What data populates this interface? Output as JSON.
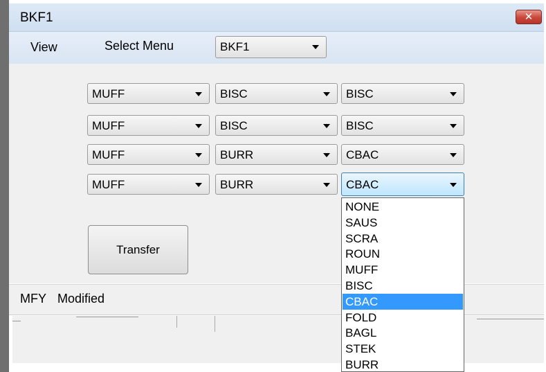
{
  "window": {
    "title": "BKF1",
    "close_label": "✕"
  },
  "menubar": {
    "view_label": "View",
    "select_menu_label": "Select Menu",
    "select_menu_value": "BKF1"
  },
  "grid": {
    "rows": [
      [
        "MUFF",
        "BISC",
        "BISC"
      ],
      [
        "MUFF",
        "BISC",
        "BISC"
      ],
      [
        "MUFF",
        "BURR",
        "CBAC"
      ],
      [
        "MUFF",
        "BURR",
        "CBAC"
      ]
    ]
  },
  "transfer_label": "Transfer",
  "status": {
    "label": "MFY",
    "text": "Modified"
  },
  "dropdown": {
    "options": [
      "NONE",
      "SAUS",
      "SCRA",
      "ROUN",
      "MUFF",
      "BISC",
      "CBAC",
      "FOLD",
      "BAGL",
      "STEK",
      "BURR"
    ],
    "selected": "CBAC"
  },
  "colors": {
    "selection": "#3399ff",
    "close_button": "#c9463a",
    "titlebar": "#dde9f6"
  }
}
